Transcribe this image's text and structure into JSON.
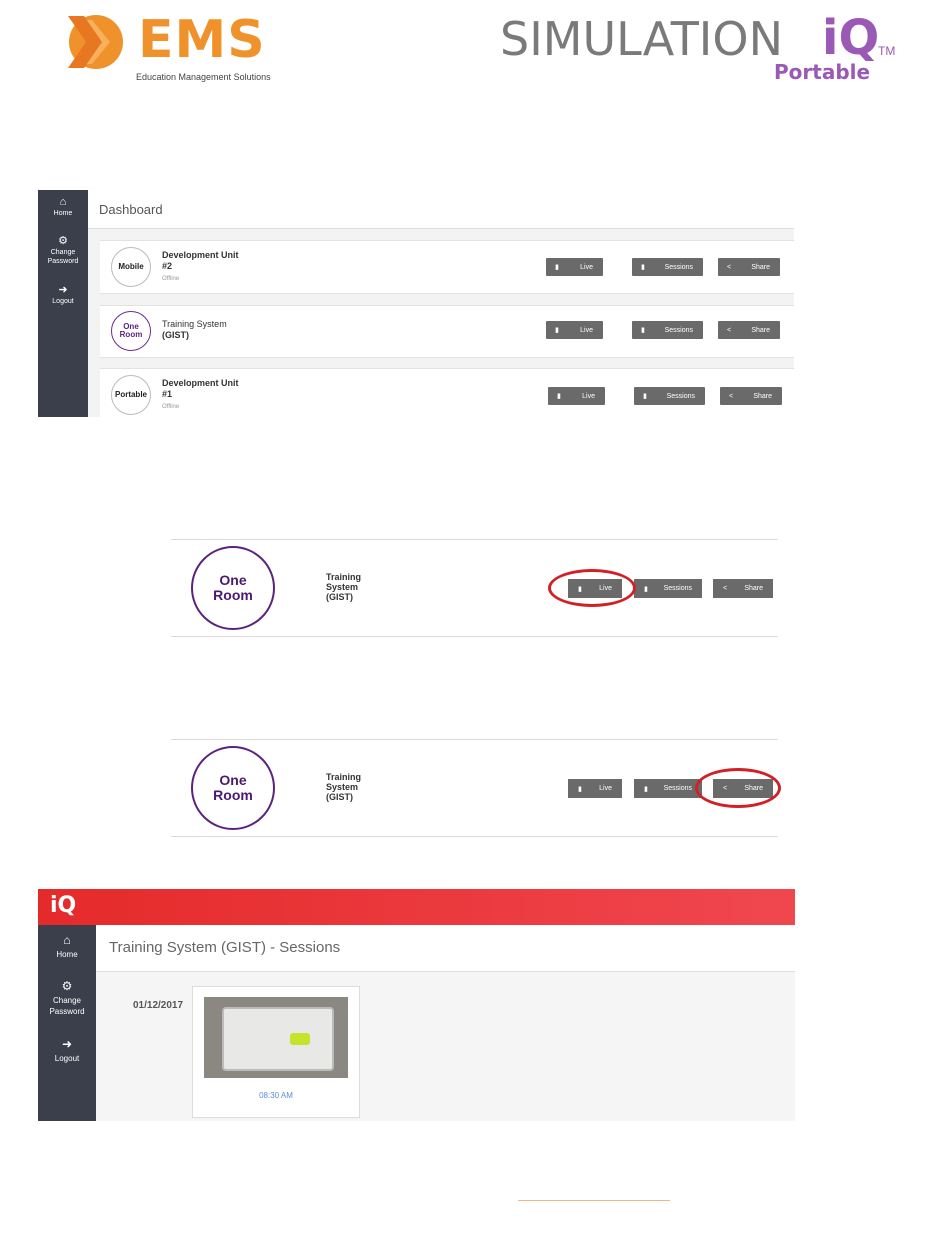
{
  "brand": {
    "ems_name": "EMS",
    "ems_tagline": "Education Management Solutions",
    "simulation_name": "SIMULATION",
    "iq_mark": "iQ",
    "trademark": "TM",
    "portable_label": "Portable",
    "colors": {
      "ems_orange": "#f0922c",
      "iq_purple": "#9b59b6",
      "topbar_red": "#e52a2a",
      "sidebar": "#3a3f4b",
      "highlight_circle": "#d32027"
    }
  },
  "dashboard": {
    "sidebar": [
      {
        "icon": "home-icon",
        "label": "Home"
      },
      {
        "icon": "gear-icon",
        "label": "Change Password"
      },
      {
        "icon": "logout-icon",
        "label": "Logout"
      }
    ],
    "title": "Dashboard",
    "devices": [
      {
        "avatar": "Mobile",
        "name_line1": "Development Unit",
        "name_line2": "#2",
        "status": "Offline"
      },
      {
        "avatar_line1": "One",
        "avatar_line2": "Room",
        "name_line1": "Training System",
        "name_line2": "(GIST)",
        "status": ""
      },
      {
        "avatar": "Portable",
        "name_line1": "Development Unit",
        "name_line2": "#1",
        "status": "Offline"
      }
    ],
    "buttons": {
      "live": "Live",
      "sessions": "Sessions",
      "share": "Share"
    }
  },
  "zoom_live": {
    "avatar_line1": "One",
    "avatar_line2": "Room",
    "name_line1": "Training",
    "name_line2": "System",
    "name_line3": "(GIST)",
    "highlighted": "Live"
  },
  "zoom_share": {
    "avatar_line1": "One",
    "avatar_line2": "Room",
    "name_line1": "Training",
    "name_line2": "System",
    "name_line3": "(GIST)",
    "highlighted": "Share"
  },
  "sessions_page": {
    "logo": "iQ",
    "sidebar": [
      {
        "icon": "home-icon",
        "label": "Home"
      },
      {
        "icon": "gear-icon",
        "label_line1": "Change",
        "label_line2": "Password"
      },
      {
        "icon": "logout-icon",
        "label": "Logout"
      }
    ],
    "title": "Training System (GIST) - Sessions",
    "date": "01/12/2017",
    "session_time": "08:30 AM"
  }
}
